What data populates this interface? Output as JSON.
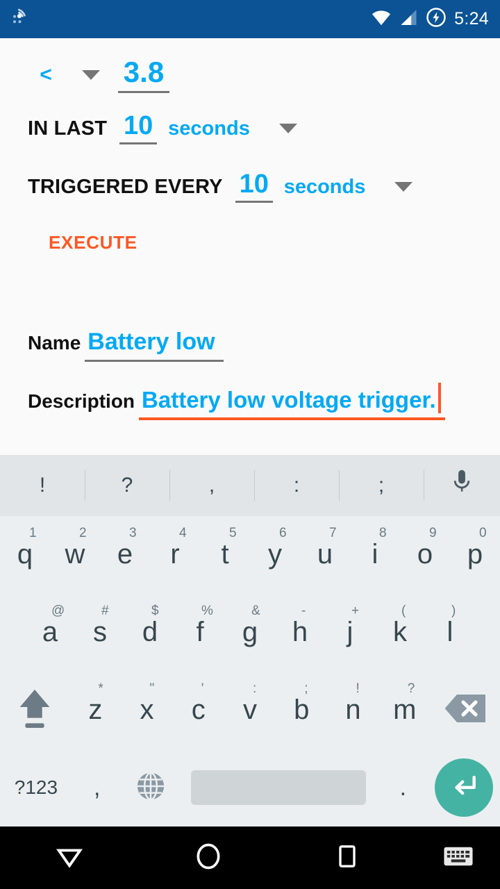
{
  "status_bar": {
    "time": "5:24",
    "background_color": "#0B5394",
    "icons": [
      "cast-icon",
      "wifi-icon",
      "cellular-signal-icon",
      "battery-charging-icon"
    ]
  },
  "form": {
    "condition": {
      "operator": "<",
      "operator_dropdown": "chevron-down-icon",
      "value": "3.8"
    },
    "in_last": {
      "label": "IN LAST",
      "value": "10",
      "unit": "seconds",
      "unit_dropdown": "chevron-down-icon"
    },
    "triggered_every": {
      "label": "TRIGGERED EVERY",
      "value": "10",
      "unit": "seconds",
      "unit_dropdown": "chevron-down-icon"
    },
    "execute_label": "EXECUTE",
    "execute_color": "#FF5722",
    "name_field": {
      "label": "Name",
      "value": "Battery low",
      "underline_color": "#757575"
    },
    "description_field": {
      "label": "Description",
      "value": "Battery low voltage trigger.",
      "underline_color": "#FF5722",
      "focused": true
    },
    "accent_color": "#03A9F4"
  },
  "keyboard": {
    "suggestions": [
      "!",
      "?",
      ",",
      ":",
      ";"
    ],
    "mic_icon": "microphone-icon",
    "row1": [
      {
        "main": "q",
        "sup": "1"
      },
      {
        "main": "w",
        "sup": "2"
      },
      {
        "main": "e",
        "sup": "3"
      },
      {
        "main": "r",
        "sup": "4"
      },
      {
        "main": "t",
        "sup": "5"
      },
      {
        "main": "y",
        "sup": "6"
      },
      {
        "main": "u",
        "sup": "7"
      },
      {
        "main": "i",
        "sup": "8"
      },
      {
        "main": "o",
        "sup": "9"
      },
      {
        "main": "p",
        "sup": "0"
      }
    ],
    "row2": [
      {
        "main": "a",
        "sup": "@"
      },
      {
        "main": "s",
        "sup": "#"
      },
      {
        "main": "d",
        "sup": "$"
      },
      {
        "main": "f",
        "sup": "%"
      },
      {
        "main": "g",
        "sup": "&"
      },
      {
        "main": "h",
        "sup": "-"
      },
      {
        "main": "j",
        "sup": "+"
      },
      {
        "main": "k",
        "sup": "("
      },
      {
        "main": "l",
        "sup": ")"
      }
    ],
    "row3": [
      {
        "main": "z",
        "sup": "*"
      },
      {
        "main": "x",
        "sup": "\""
      },
      {
        "main": "c",
        "sup": "'"
      },
      {
        "main": "v",
        "sup": ":"
      },
      {
        "main": "b",
        "sup": ";"
      },
      {
        "main": "n",
        "sup": "!"
      },
      {
        "main": "m",
        "sup": "?"
      }
    ],
    "shift_icon": "shift-arrow-icon",
    "delete_icon": "backspace-icon",
    "symbols_label": "?123",
    "comma_label": ",",
    "globe_icon": "language-globe-icon",
    "space_label": "",
    "period_label": ".",
    "enter_icon": "enter-return-icon",
    "enter_color": "#45B3A3",
    "background_color": "#ECEFF1",
    "suggestion_bar_color": "#E1E5E8"
  },
  "nav_bar": {
    "back_icon": "back-down-triangle-icon",
    "home_icon": "home-circle-icon",
    "recents_icon": "recents-square-icon",
    "keyboard_indicator_icon": "keyboard-icon",
    "background_color": "#000000"
  }
}
